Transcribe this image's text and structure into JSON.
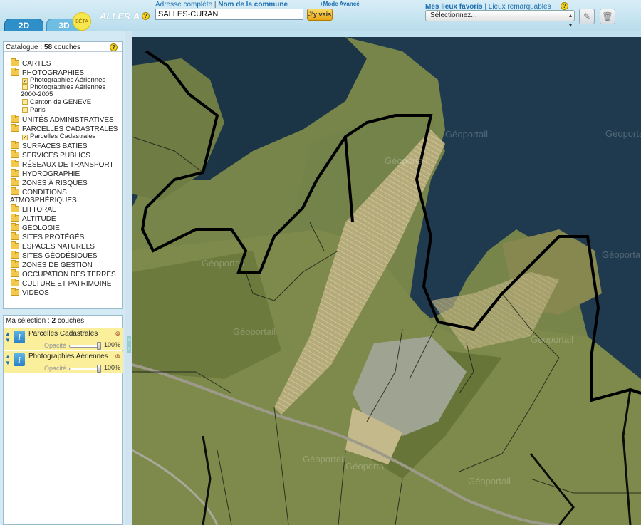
{
  "header": {
    "tab_2d": "2D",
    "tab_3d": "3D",
    "beta": "BÊTA",
    "aller_a": "ALLER À",
    "mode_address": "Adresse complète",
    "mode_separator": "|",
    "mode_commune": "Nom de la commune",
    "search_value": "SALLES-CURAN",
    "go_label": "J'y vais",
    "advanced_mode": "+Mode Avancé",
    "favorites": "Mes lieux favoris",
    "fav_separator": "|",
    "remarkable": "Lieux remarquables",
    "select_value": "Sélectionnez...",
    "help": "?"
  },
  "catalog": {
    "label": "Catalogue : ",
    "count": "58",
    "unit": " couches",
    "help": "?",
    "items": [
      "CARTES",
      "PHOTOGRAPHIES",
      "UNITÉS ADMINISTRATIVES",
      "PARCELLES CADASTRALES",
      "SURFACES BATIES",
      "SERVICES PUBLICS",
      "RÉSEAUX DE TRANSPORT",
      "HYDROGRAPHIE",
      "ZONES À RISQUES",
      "CONDITIONS",
      "ATMOSPHÉRIQUES",
      "LITTORAL",
      "ALTITUDE",
      "GÉOLOGIE",
      "SITES PROTÉGÉS",
      "ESPACES NATURELS",
      "SITES GÉODÉSIQUES",
      "ZONES DE GESTION",
      "OCCUPATION DES TERRES",
      "CULTURE ET PATRIMOINE",
      "VIDÉOS"
    ],
    "photo_sub": [
      {
        "label": "Photographies Aériennes",
        "checked": true
      },
      {
        "label": "Photographies Aériennes",
        "checked": false
      },
      {
        "label": "2000-2005",
        "checked": false
      },
      {
        "label": "Canton de GENEVE",
        "checked": false
      },
      {
        "label": "Paris",
        "checked": false
      }
    ],
    "cadastre_sub": [
      {
        "label": "Parcelles Cadastrales",
        "checked": true
      }
    ]
  },
  "selection": {
    "label": "Ma sélection : ",
    "count": "2",
    "unit": " couches",
    "layers": [
      {
        "name": "Parcelles Cadastrales",
        "opacity_label": "Opacité",
        "opacity": "100%",
        "opacity_value": 1.0
      },
      {
        "name": "Photographies Aériennes",
        "opacity_label": "Opacité",
        "opacity": "100%",
        "opacity_value": 1.0
      }
    ]
  },
  "map": {
    "watermark": "Géoportail",
    "colors": {
      "water": "#1f3a4e",
      "field": "#7e8a4a",
      "parcel_line": "#000000"
    }
  }
}
